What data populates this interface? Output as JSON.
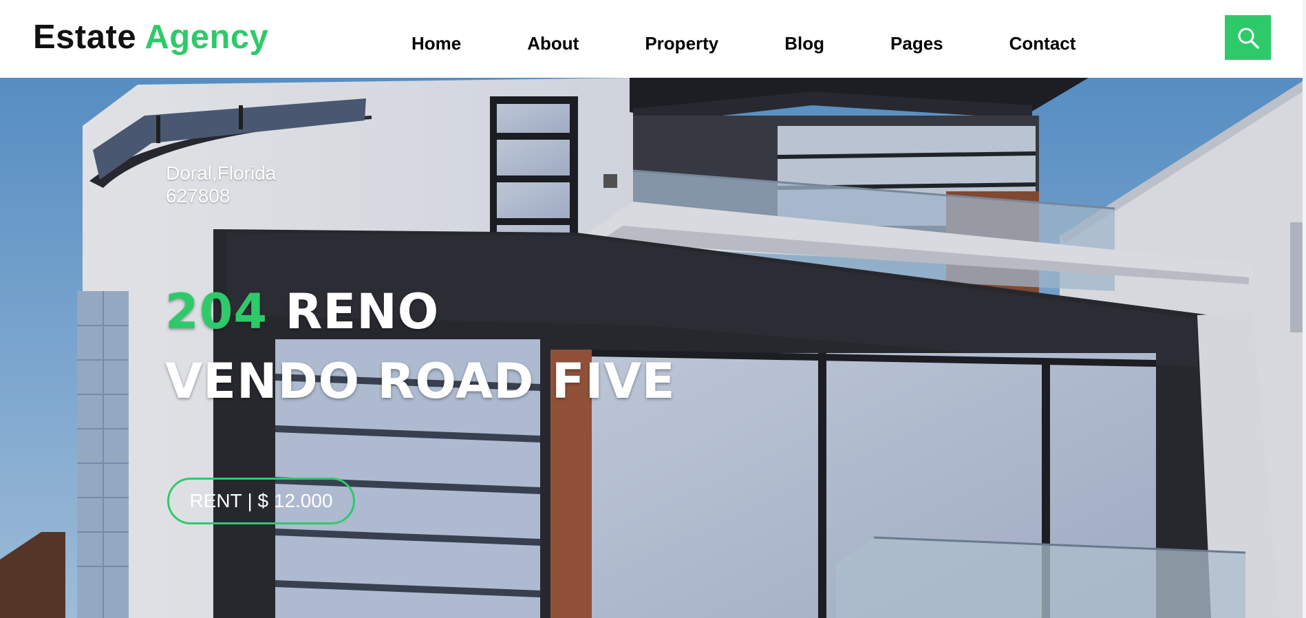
{
  "brand": {
    "first": "Estate",
    "second": "Agency"
  },
  "nav": {
    "items": [
      "Home",
      "About",
      "Property",
      "Blog",
      "Pages",
      "Contact"
    ]
  },
  "search": {
    "icon": "search-icon"
  },
  "hero": {
    "location_line1": "Doral,Florida",
    "location_line2": "627808",
    "title_number": "204",
    "title_rest_line1": "RENO",
    "title_line2": "VENDO ROAD FIVE",
    "price_type": "RENT",
    "price_separator": " | ",
    "price_value": "$ 12.000"
  },
  "colors": {
    "accent": "#2eca6a",
    "text_dark": "#111111",
    "white": "#ffffff"
  }
}
